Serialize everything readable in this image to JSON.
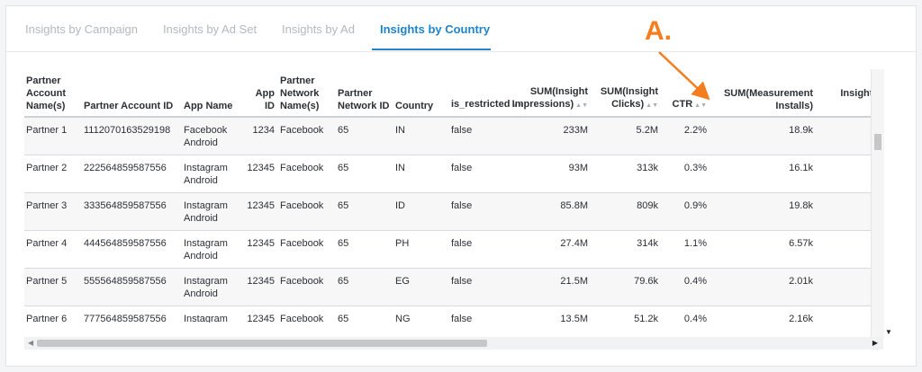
{
  "tabs": [
    {
      "label": "Insights by Campaign",
      "active": false
    },
    {
      "label": "Insights by Ad Set",
      "active": false
    },
    {
      "label": "Insights by Ad",
      "active": false
    },
    {
      "label": "Insights by Country",
      "active": true
    }
  ],
  "annotation": {
    "label": "A.",
    "color": "#f47d20"
  },
  "columns": [
    {
      "label": "Partner Account Name(s)",
      "align": "left"
    },
    {
      "label": "Partner Account ID",
      "align": "left"
    },
    {
      "label": "App Name",
      "align": "left"
    },
    {
      "label": "App ID",
      "align": "right"
    },
    {
      "label": "Partner Network Name(s)",
      "align": "left"
    },
    {
      "label": "Partner Network ID",
      "align": "left"
    },
    {
      "label": "Country",
      "align": "left"
    },
    {
      "label": "is_restricted",
      "align": "left"
    },
    {
      "label": "SUM(Insight Impressions)",
      "align": "right"
    },
    {
      "label": "SUM(Insight Clicks)",
      "align": "right"
    },
    {
      "label": "CTR",
      "align": "right"
    },
    {
      "label": "SUM(Measurement Installs)",
      "align": "right"
    },
    {
      "label": "Insight Conversion Rate",
      "align": "right"
    }
  ],
  "rows": [
    [
      "Partner 1",
      "1112070163529198",
      "Facebook Android",
      "1234",
      "Facebook",
      "65",
      "IN",
      "false",
      "233M",
      "5.2M",
      "2.2%",
      "18.9k",
      ""
    ],
    [
      "Partner 2",
      "222564859587556",
      "Instagram Android",
      "12345",
      "Facebook",
      "65",
      "IN",
      "false",
      "93M",
      "313k",
      "0.3%",
      "16.1k",
      ""
    ],
    [
      "Partner 3",
      "333564859587556",
      "Instagram Android",
      "12345",
      "Facebook",
      "65",
      "ID",
      "false",
      "85.8M",
      "809k",
      "0.9%",
      "19.8k",
      ""
    ],
    [
      "Partner 4",
      "444564859587556",
      "Instagram Android",
      "12345",
      "Facebook",
      "65",
      "PH",
      "false",
      "27.4M",
      "314k",
      "1.1%",
      "6.57k",
      ""
    ],
    [
      "Partner 5",
      "555564859587556",
      "Instagram Android",
      "12345",
      "Facebook",
      "65",
      "EG",
      "false",
      "21.5M",
      "79.6k",
      "0.4%",
      "2.01k",
      ""
    ],
    [
      "Partner 6",
      "777564859587556",
      "Instagram Android",
      "12345",
      "Facebook",
      "65",
      "NG",
      "false",
      "13.5M",
      "51.2k",
      "0.4%",
      "2.16k",
      ""
    ]
  ],
  "icons": {
    "sort": "sort-icon",
    "scroll_left": "scroll-left-icon",
    "scroll_right": "scroll-right-icon",
    "scroll_down": "scroll-down-icon"
  },
  "colors": {
    "accent": "#1f84c9",
    "annotation": "#f47d20",
    "tab_inactive": "#b3b8bf"
  }
}
